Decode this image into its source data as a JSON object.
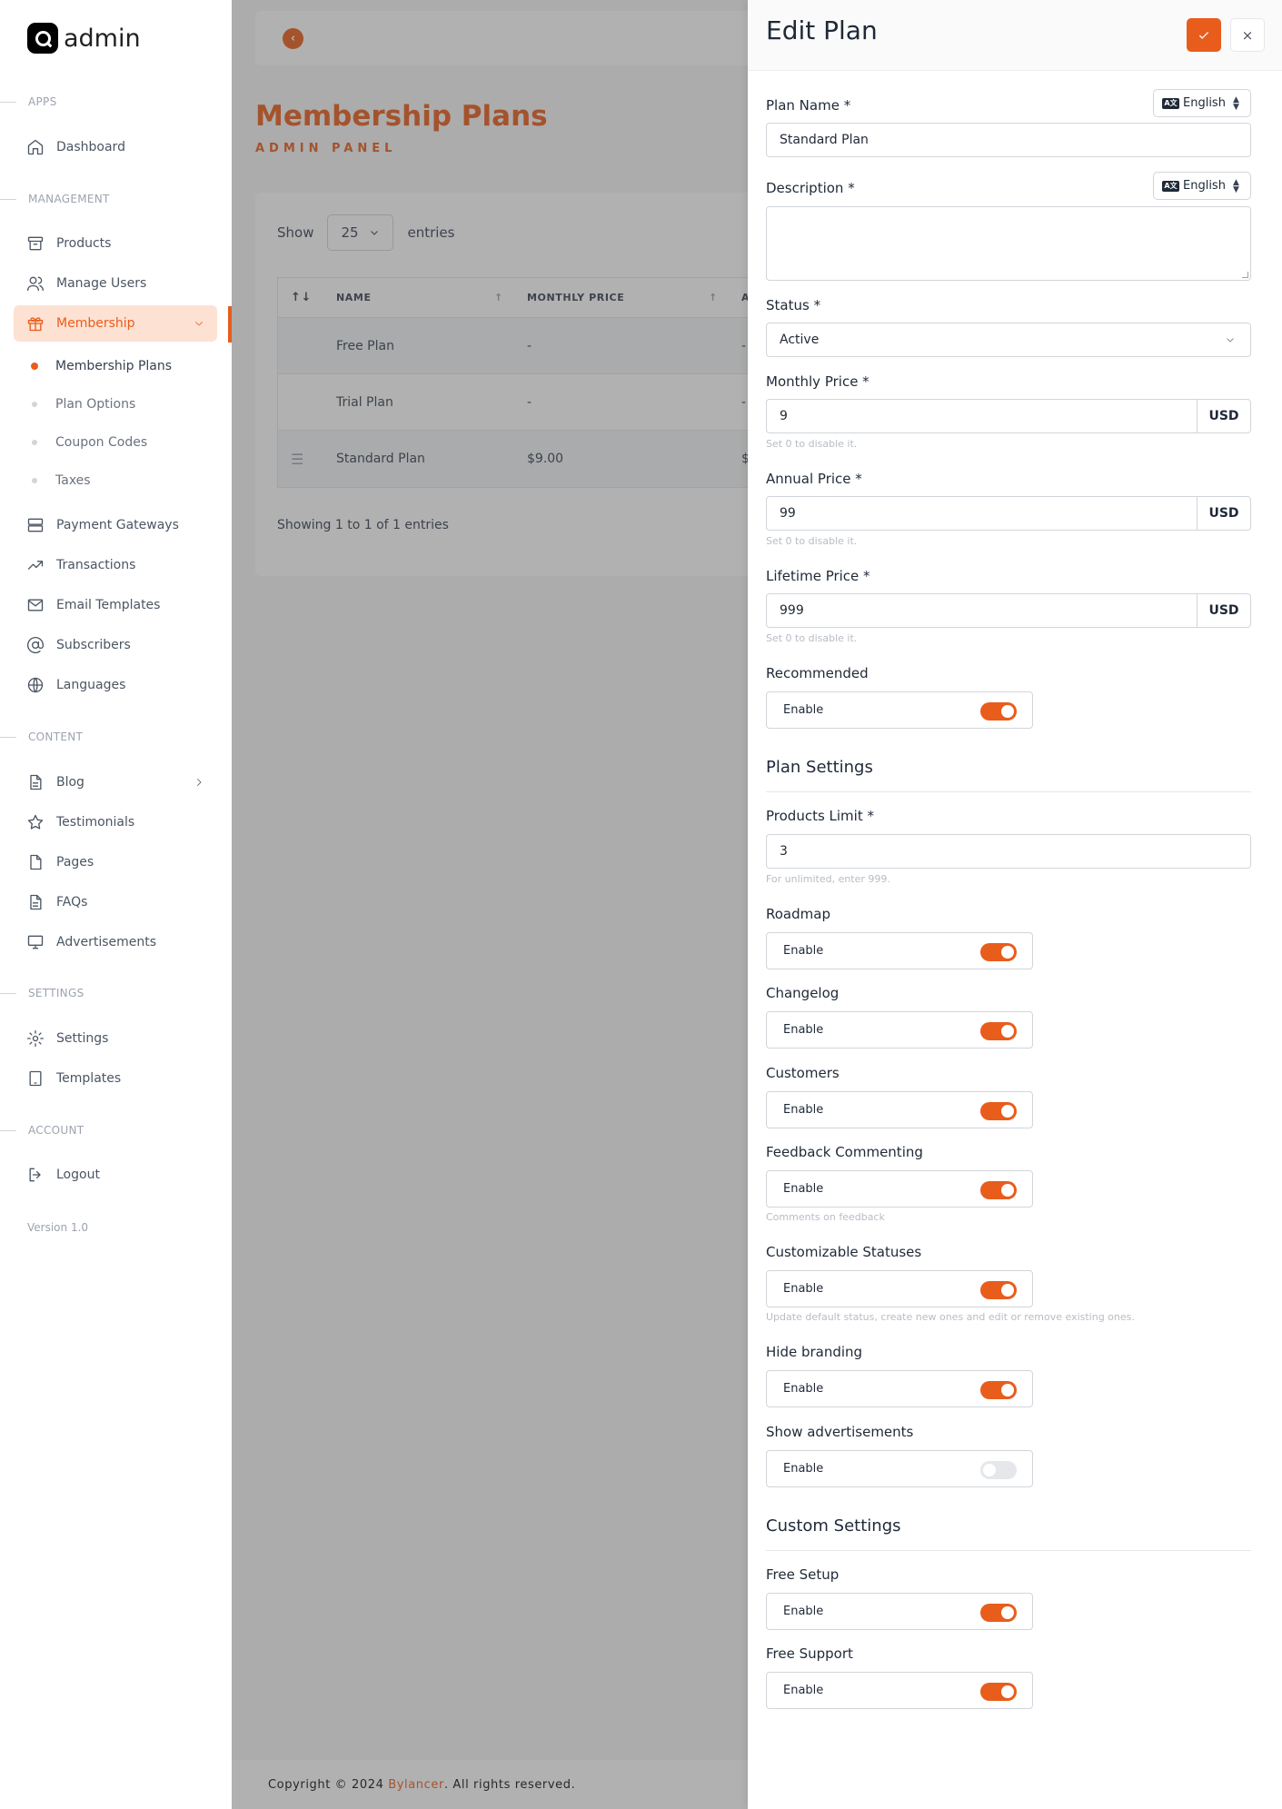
{
  "app": {
    "logo_text": "admin"
  },
  "sidebar": {
    "sections": {
      "apps": "APPS",
      "management": "MANAGEMENT",
      "content": "CONTENT",
      "settings": "SETTINGS",
      "account": "ACCOUNT"
    },
    "items": {
      "dashboard": "Dashboard",
      "products": "Products",
      "manage_users": "Manage Users",
      "membership": "Membership",
      "payment_gateways": "Payment Gateways",
      "transactions": "Transactions",
      "email_templates": "Email Templates",
      "subscribers": "Subscribers",
      "languages": "Languages",
      "blog": "Blog",
      "testimonials": "Testimonials",
      "pages": "Pages",
      "faqs": "FAQs",
      "advertisements": "Advertisements",
      "settings": "Settings",
      "templates": "Templates",
      "logout": "Logout"
    },
    "membership_sub": [
      "Membership Plans",
      "Plan Options",
      "Coupon Codes",
      "Taxes"
    ],
    "version": "Version 1.0"
  },
  "main": {
    "title": "Membership Plans",
    "subtitle": "ADMIN PANEL",
    "show_label": "Show",
    "show_value": "25",
    "entries_label": "entries",
    "table": {
      "headers": [
        "NAME",
        "MONTHLY PRICE",
        "A"
      ],
      "rows": [
        {
          "name": "Free Plan",
          "monthly": "-",
          "next": "-"
        },
        {
          "name": "Trial Plan",
          "monthly": "-",
          "next": "-"
        },
        {
          "name": "Standard Plan",
          "monthly": "$9.00",
          "next": "$"
        }
      ]
    },
    "entries_info": "Showing 1 to 1 of 1 entries",
    "footer": {
      "prefix": "Copyright © 2024 ",
      "brand": "Bylancer",
      "suffix": ". All rights reserved."
    }
  },
  "panel": {
    "title": "Edit Plan",
    "close_label": "×",
    "lang_label": "English",
    "plan_name": {
      "label": "Plan Name *",
      "value": "Standard Plan"
    },
    "description": {
      "label": "Description *"
    },
    "status": {
      "label": "Status *",
      "value": "Active"
    },
    "monthly_price": {
      "label": "Monthly Price *",
      "value": "9",
      "currency": "USD",
      "hint": "Set 0 to disable it."
    },
    "annual_price": {
      "label": "Annual Price *",
      "value": "99",
      "currency": "USD",
      "hint": "Set 0 to disable it."
    },
    "lifetime_price": {
      "label": "Lifetime Price *",
      "value": "999",
      "currency": "USD",
      "hint": "Set 0 to disable it."
    },
    "enable_label": "Enable",
    "recommended": {
      "label": "Recommended",
      "enabled": true
    },
    "plan_settings_title": "Plan Settings",
    "products_limit": {
      "label": "Products Limit *",
      "value": "3",
      "hint": "For unlimited, enter 999."
    },
    "roadmap": {
      "label": "Roadmap",
      "enabled": true
    },
    "changelog": {
      "label": "Changelog",
      "enabled": true
    },
    "customers": {
      "label": "Customers",
      "enabled": true
    },
    "feedback_commenting": {
      "label": "Feedback Commenting",
      "enabled": true,
      "hint": "Comments on feedback"
    },
    "customizable_statuses": {
      "label": "Customizable Statuses",
      "enabled": true,
      "hint": "Update default status, create new ones and edit or remove existing ones."
    },
    "hide_branding": {
      "label": "Hide branding",
      "enabled": true
    },
    "show_advertisements": {
      "label": "Show advertisements",
      "enabled": false
    },
    "custom_settings_title": "Custom Settings",
    "free_setup": {
      "label": "Free Setup",
      "enabled": true
    },
    "free_support": {
      "label": "Free Support",
      "enabled": true
    }
  },
  "colors": {
    "accent": "#e85d1c",
    "active_bg": "#fde1d3"
  }
}
